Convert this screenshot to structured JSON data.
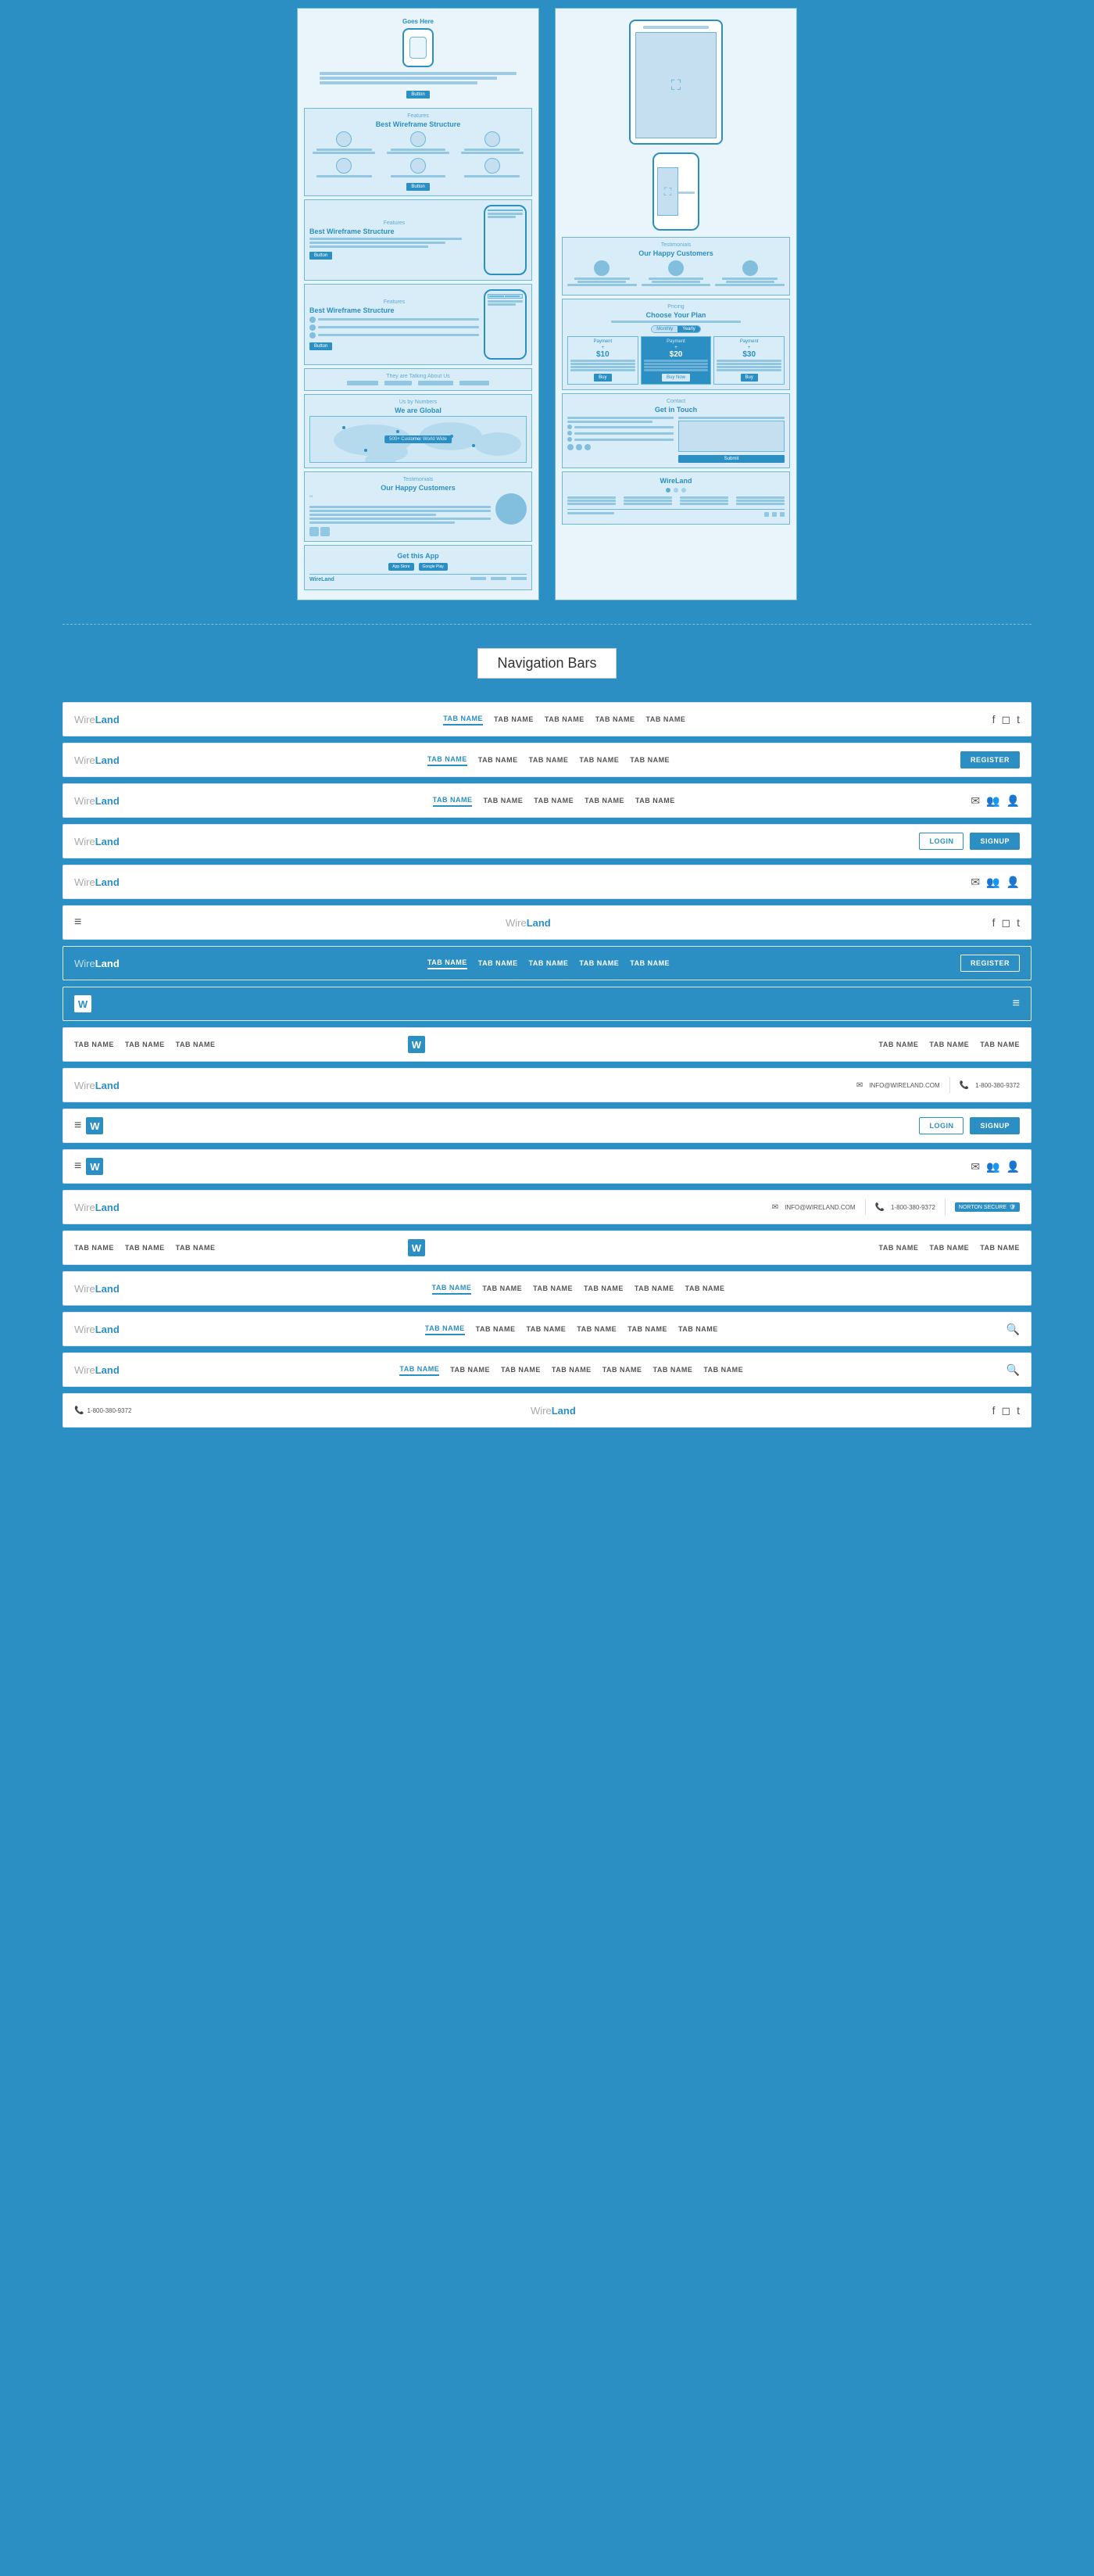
{
  "section_title": "Navigation Bars",
  "navbars": [
    {
      "id": "nb1",
      "logo": "Wire|Land",
      "tabs": [
        "TAB NAME",
        "TAB NAME",
        "TAB NAME",
        "TAB NAME",
        "TAB NAME"
      ],
      "active_tab": 0,
      "actions": [
        "facebook",
        "instagram",
        "twitter"
      ]
    },
    {
      "id": "nb2",
      "logo": "Wire|Land",
      "tabs": [
        "TAB NAME",
        "TAB NAME",
        "TAB NAME",
        "TAB NAME",
        "TAB NAME"
      ],
      "active_tab": 0,
      "actions": [
        "register_btn"
      ]
    },
    {
      "id": "nb3",
      "logo": "Wire|Land",
      "tabs": [
        "TAB NAME",
        "TAB NAME",
        "TAB NAME",
        "TAB NAME",
        "TAB NAME"
      ],
      "active_tab": 0,
      "actions": [
        "email",
        "user_add",
        "user"
      ]
    },
    {
      "id": "nb4",
      "logo": "Wire|Land",
      "tabs": [],
      "actions": [
        "login_btn",
        "signup_btn"
      ]
    },
    {
      "id": "nb5",
      "logo": "Wire|Land",
      "tabs": [],
      "actions": [
        "email",
        "user_add",
        "user"
      ]
    },
    {
      "id": "nb6",
      "logo": null,
      "left_icon": "hamburger",
      "center_logo": "Wire|Land",
      "tabs": [],
      "actions": [
        "facebook",
        "instagram",
        "twitter"
      ],
      "style": "centered"
    },
    {
      "id": "nb7",
      "logo": "Wire|Land",
      "tabs": [
        "TAB NAME",
        "TAB NAME",
        "TAB NAME",
        "TAB NAME",
        "TAB NAME"
      ],
      "active_tab": 0,
      "actions": [
        "register_btn"
      ],
      "style": "blue"
    },
    {
      "id": "nb8",
      "logo": "W",
      "tabs": [],
      "actions": [
        "hamburger"
      ],
      "style": "blue"
    },
    {
      "id": "nb9",
      "tabs_left": [
        "TAB NAME",
        "TAB NAME",
        "TAB NAME"
      ],
      "center_logo": "W",
      "tabs_right": [
        "TAB NAME",
        "TAB NAME",
        "TAB NAME"
      ],
      "style": "centered_logo"
    },
    {
      "id": "nb10",
      "logo": "Wire|Land",
      "tabs": [],
      "actions": [
        "email info@wireland.com",
        "phone 1-800-380-9372"
      ]
    },
    {
      "id": "nb11",
      "left_icons": [
        "hamburger",
        "W"
      ],
      "tabs": [],
      "actions": [
        "login_btn",
        "signup_btn"
      ]
    },
    {
      "id": "nb12",
      "left_icons": [
        "hamburger",
        "W"
      ],
      "tabs": [],
      "actions": [
        "email",
        "user_add",
        "user"
      ]
    },
    {
      "id": "nb13",
      "logo": "Wire|Land",
      "tabs": [],
      "actions": [
        "email info@wireland.com",
        "phone 1-800-380-9372",
        "secure badge"
      ]
    },
    {
      "id": "nb14",
      "tabs_center": [
        "TAB NAME",
        "TAB NAME",
        "TAB NAME"
      ],
      "center_logo": "W",
      "tabs_right": [
        "TAB NAME",
        "TAB NAME",
        "TAB NAME"
      ],
      "style": "centered_logo2"
    },
    {
      "id": "nb15",
      "logo": "Wire|Land",
      "tabs": [
        "TAB NAME",
        "TAB NAME",
        "TAB NAME",
        "TAB NAME",
        "TAB NAME",
        "TAB NAME"
      ],
      "active_tab": 0,
      "actions": []
    },
    {
      "id": "nb16",
      "logo": "Wire|Land",
      "tabs": [
        "TAB NAME",
        "TAB NAME",
        "TAB NAME",
        "TAB NAME",
        "TAB NAME",
        "TAB NAME"
      ],
      "active_tab": 0,
      "actions": [
        "search"
      ]
    },
    {
      "id": "nb17",
      "logo": "Wire|Land",
      "tabs": [
        "TAB NAME",
        "TAB NAME",
        "TAB NAME",
        "TAB NAME",
        "TAB NAME",
        "TAB NAME",
        "TAB NAME"
      ],
      "active_tab": 0,
      "actions": [
        "search"
      ]
    },
    {
      "id": "nb18",
      "logo": "Wire|Land",
      "left_icons": [
        "phone 1-800-380-9372"
      ],
      "tabs": [],
      "center_logo": "Wire|Land",
      "actions": [
        "facebook",
        "instagram",
        "twitter"
      ],
      "style": "footer"
    }
  ],
  "wireframe": {
    "left_page_sections": [
      "Goes Here",
      "Features",
      "Best Wireframe Structure",
      "Features",
      "Best Wireframe Structure",
      "Features",
      "Best Wireframe Structure",
      "They are Talking About Us",
      "Us by Numbers",
      "We are Global",
      "Testimonials",
      "Our Happy Customers",
      "Get this App"
    ],
    "right_page_sections": [
      "Device mockups",
      "Testimonials",
      "Our Happy Customers",
      "Pricing",
      "Choose Your Plan",
      "Contact",
      "Get in Touch",
      "WireLand footer"
    ]
  },
  "labels": {
    "tab_name": "TAB NAME",
    "register": "REGISTER",
    "login": "LOGIN",
    "signup": "SIGNUP",
    "facebook_icon": "f",
    "instagram_icon": "◻",
    "twitter_icon": "t",
    "email_icon": "✉",
    "user_icon": "👤",
    "user_add_icon": "👥",
    "search_icon": "🔍",
    "hamburger_icon": "≡",
    "phone_icon": "📞",
    "shield_icon": "🛡",
    "info_email": "INFO@WIRELAND.COM",
    "info_phone": "1-800-380-9372",
    "secure_text": "NORTON SECURE",
    "wire": "Wire",
    "land": "Land",
    "w_letter": "W"
  }
}
